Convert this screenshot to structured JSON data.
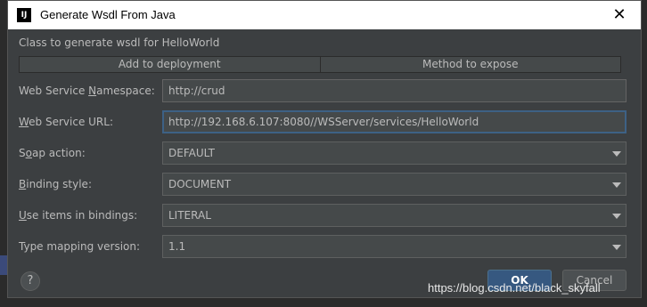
{
  "window": {
    "title": "Generate Wsdl From Java"
  },
  "dialog": {
    "subtitle": "Class to generate wsdl for HelloWorld",
    "tabs": [
      {
        "label": "Add to deployment"
      },
      {
        "label": "Method to expose"
      }
    ],
    "fields": {
      "namespace": {
        "label_pre": "Web Service ",
        "label_u": "N",
        "label_post": "amespace:",
        "value": "http://crud"
      },
      "url": {
        "label_pre": "",
        "label_u": "W",
        "label_post": "eb Service URL:",
        "value": "http://192.168.6.107:8080//WSServer/services/HelloWorld"
      },
      "soap_action": {
        "label_pre": "S",
        "label_u": "o",
        "label_post": "ap action:",
        "value": "DEFAULT"
      },
      "binding_style": {
        "label_pre": "",
        "label_u": "B",
        "label_post": "inding style:",
        "value": "DOCUMENT"
      },
      "use_items": {
        "label_pre": "",
        "label_u": "U",
        "label_post": "se items in bindings:",
        "value": "LITERAL"
      },
      "type_mapping": {
        "label_pre": "Type mapping version:",
        "label_u": "",
        "label_post": "",
        "value": "1.1"
      }
    },
    "buttons": {
      "help": "?",
      "ok": "OK",
      "cancel": "Cancel"
    }
  },
  "watermark": "https://blog.csdn.net/black_skyfall",
  "colors": {
    "accent": "#365880",
    "background": "#3c3f41",
    "field": "#45494a",
    "focus_border": "#3d6185"
  }
}
